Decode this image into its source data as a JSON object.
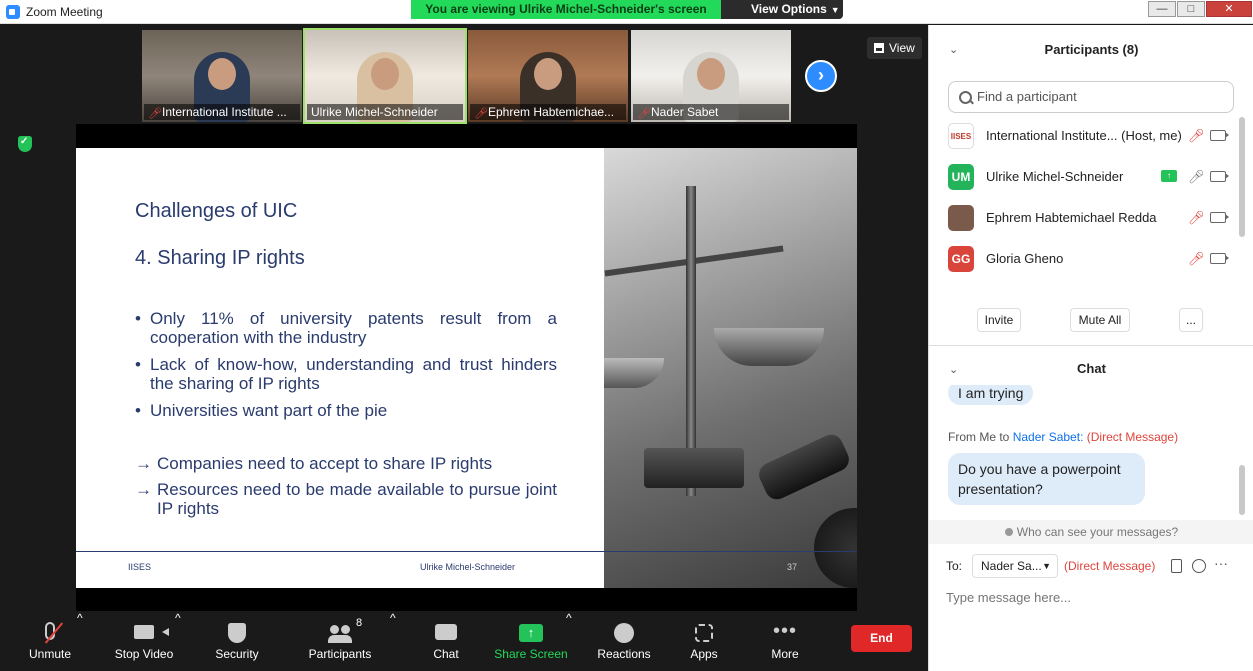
{
  "window": {
    "title": "Zoom Meeting"
  },
  "banner": {
    "text": "You are viewing Ulrike Michel-Schneider's screen",
    "view_options": "View Options"
  },
  "window_controls": [
    "—",
    "□",
    "✕"
  ],
  "view_button": "View",
  "thumbnails": [
    {
      "name": "International Institute ...",
      "muted": true
    },
    {
      "name": "Ulrike Michel-Schneider",
      "muted": false
    },
    {
      "name": "Ephrem Habtemichae...",
      "muted": true
    },
    {
      "name": "Nader Sabet",
      "muted": true
    }
  ],
  "slide": {
    "title": "Challenges of UIC",
    "subtitle": "4. Sharing IP rights",
    "bullets": [
      "Only 11% of university patents result from a cooperation with the industry",
      "Lack of know-how, understanding and trust hinders the sharing of IP rights",
      "Universities want part of the pie"
    ],
    "arrows": [
      "Companies need to accept to share IP rights",
      "Resources need to be made available to pursue joint IP rights"
    ],
    "footer_left": "IISES",
    "footer_mid": "Ulrike Michel-Schneider",
    "footer_num": "37"
  },
  "toolbar": {
    "unmute": "Unmute",
    "stop_video": "Stop Video",
    "security": "Security",
    "participants": "Participants",
    "participants_count": "8",
    "chat": "Chat",
    "share_screen": "Share Screen",
    "reactions": "Reactions",
    "apps": "Apps",
    "more": "More",
    "end": "End"
  },
  "participants": {
    "title": "Participants (8)",
    "search_placeholder": "Find a participant",
    "list": [
      {
        "avatar": "IISES",
        "name": "International Institute... (Host, me)",
        "muted": true,
        "avatar_color": "#ffffff"
      },
      {
        "avatar": "UM",
        "name": "Ulrike Michel-Schneider",
        "muted": false,
        "sharing": true,
        "avatar_color": "#23b35a"
      },
      {
        "avatar": "",
        "name": "Ephrem Habtemichael Redda",
        "muted": true,
        "avatar_color": "#7a5a4a"
      },
      {
        "avatar": "GG",
        "name": "Gloria Gheno",
        "muted": true,
        "avatar_color": "#d9453a"
      }
    ],
    "invite": "Invite",
    "mute_all": "Mute All",
    "more": "..."
  },
  "chat": {
    "title": "Chat",
    "prev_message": "I am trying",
    "from_prefix": "From Me to",
    "from_to": "Nader Sabet:",
    "from_dm": "(Direct Message)",
    "message": "Do you have a powerpoint presentation?",
    "who_can_see": "Who can see your messages?",
    "to_label": "To:",
    "to_value": "Nader Sa...",
    "dm_label": "(Direct Message)",
    "input_placeholder": "Type message here..."
  },
  "colors": {
    "accent": "#2d8cff",
    "banner": "#23d959",
    "end": "#e02828",
    "slide_text": "#2a3b6e"
  }
}
